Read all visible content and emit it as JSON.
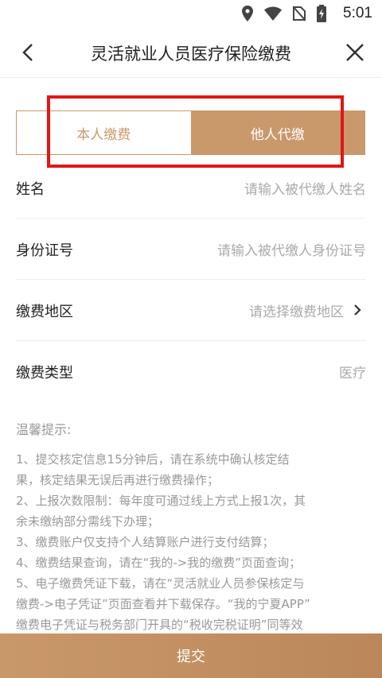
{
  "status_bar": {
    "time": "5:01",
    "icons": [
      "location-icon",
      "wifi-icon",
      "no-sim-icon",
      "battery-charging-icon"
    ]
  },
  "nav": {
    "title": "灵活就业人员医疗保险缴费",
    "back_icon": "chevron-left-icon",
    "close_icon": "close-icon"
  },
  "tabs": {
    "self_label": "本人缴费",
    "other_label": "他人代缴",
    "active": "other"
  },
  "form": {
    "name": {
      "label": "姓名",
      "placeholder": "请输入被代缴人姓名"
    },
    "id_number": {
      "label": "身份证号",
      "placeholder": "请输入被代缴人身份证号"
    },
    "region": {
      "label": "缴费地区",
      "placeholder": "请选择缴费地区"
    },
    "type": {
      "label": "缴费类型",
      "value": "医疗"
    }
  },
  "tips": {
    "title": "温馨提示:",
    "lines": [
      "1、提交核定信息15分钟后，请在系统中确认核定结",
      "果，核定结果无误后再进行缴费操作；",
      "2、上报次数限制：每年度可通过线上方式上报1次，其",
      "余未缴纳部分需线下办理；",
      "3、缴费账户仅支持个人结算账户进行支付结算；",
      "4、缴费结果查询，请在“我的->我的缴费”页面查询；",
      "5、电子缴费凭证下载，请在“灵活就业人员参保核定与",
      "缴费->电子凭证”页面查看并下载保存。“我的宁夏APP”",
      "缴费电子凭证与税务部门开具的“税收完税证明”同等效"
    ]
  },
  "submit_label": "提交",
  "colors": {
    "accent": "#c9996b",
    "highlight_box": "#e21616"
  }
}
